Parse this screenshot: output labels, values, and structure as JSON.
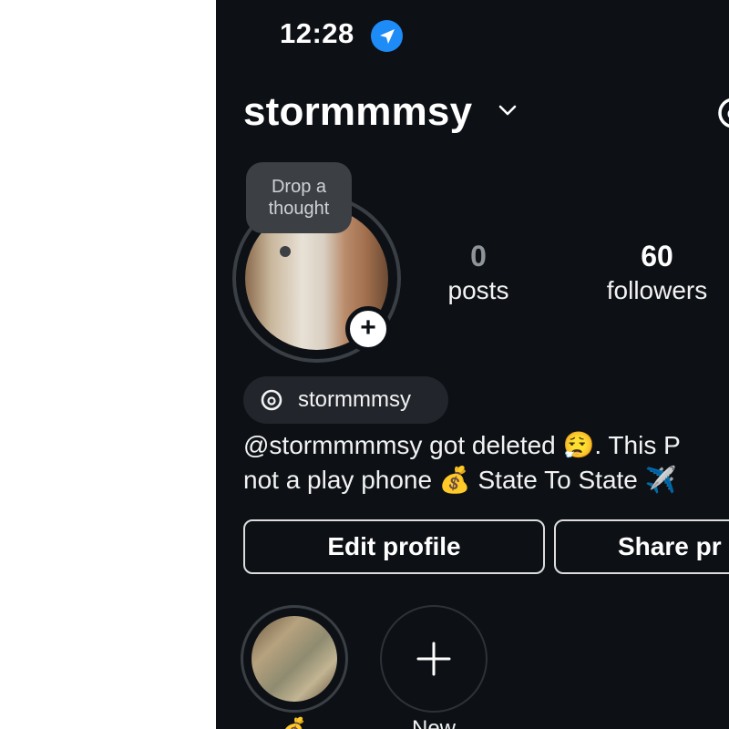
{
  "status_bar": {
    "time": "12:28",
    "location_icon": "location-arrow-icon",
    "accent_color": "#1e8cf7"
  },
  "header": {
    "username": "stormmmsy",
    "dropdown_icon": "chevron-down-icon",
    "threads_icon": "threads-icon"
  },
  "profile": {
    "note_bubble": "Drop a thought",
    "add_story_icon": "plus-icon"
  },
  "stats": {
    "posts_count": "0",
    "posts_label": "posts",
    "followers_count": "60",
    "followers_label": "followers"
  },
  "threads_badge": {
    "icon": "threads-icon",
    "label": "stormmmsy"
  },
  "bio": {
    "line1": "@stormmmmsy got deleted 😮‍💨. This P",
    "line2": "not a play phone 💰 State To State ✈️"
  },
  "actions": {
    "edit_label": "Edit profile",
    "share_label": "Share pr"
  },
  "highlights": {
    "items": [
      {
        "label": "💰"
      },
      {
        "label": "New",
        "icon": "plus-icon"
      }
    ]
  },
  "theme": {
    "background": "#0d1116",
    "pill": "#22262c",
    "muted_number": "#8f949a"
  }
}
